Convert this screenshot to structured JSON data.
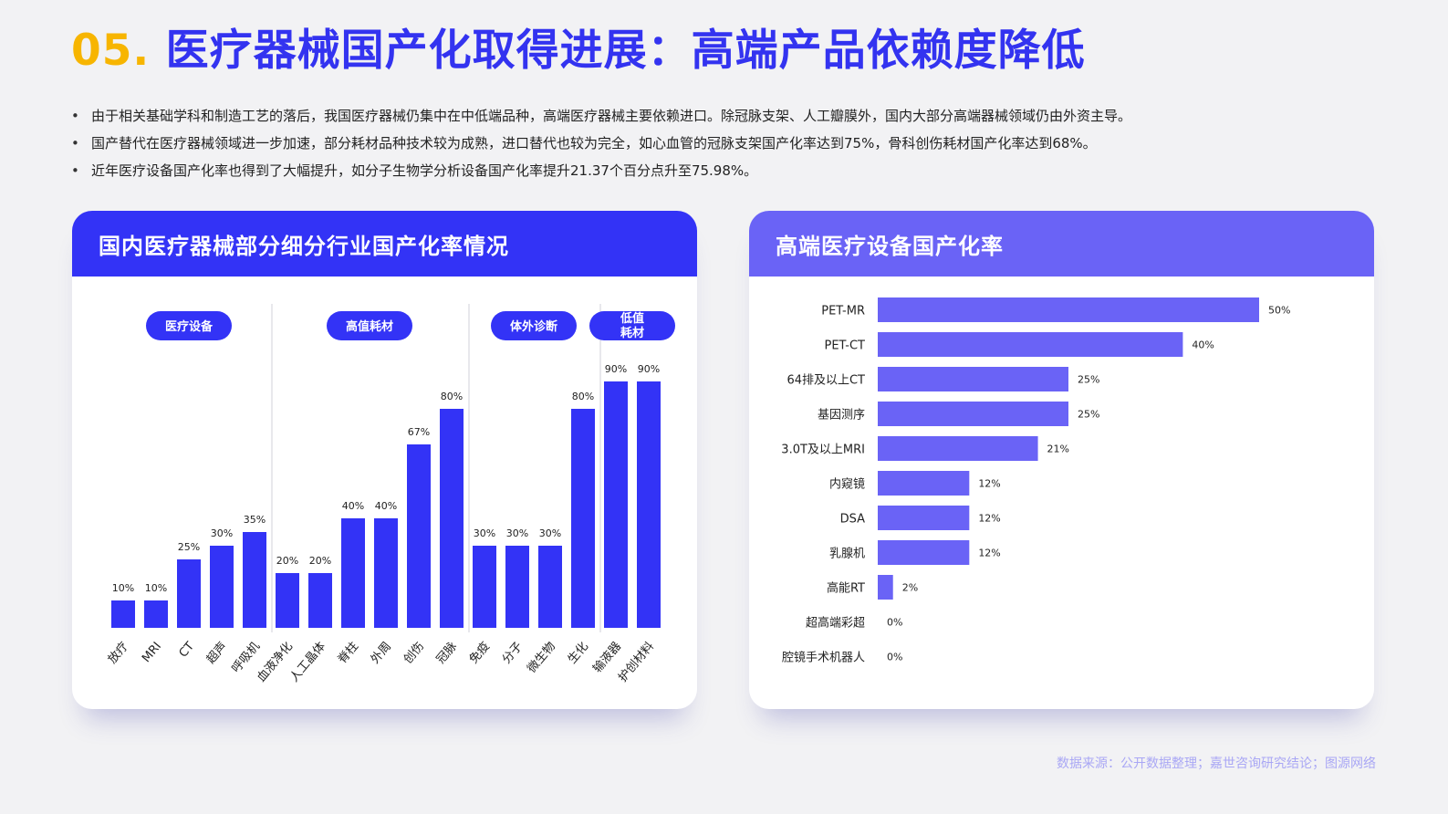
{
  "title": {
    "number": "05.",
    "text": "医疗器械国产化取得进展：高端产品依赖度降低"
  },
  "bullets": [
    "由于相关基础学科和制造工艺的落后，我国医疗器械仍集中在中低端品种，高端医疗器械主要依赖进口。除冠脉支架、人工瓣膜外，国内大部分高端器械领域仍由外资主导。",
    "国产替代在医疗器械领域进一步加速，部分耗材品种技术较为成熟，进口替代也较为完全，如心血管的冠脉支架国产化率达到75%，骨科创伤耗材国产化率达到68%。",
    "近年医疗设备国产化率也得到了大幅提升，如分子生物学分析设备国产化率提升21.37个百分点升至75.98%。"
  ],
  "colors": {
    "bar_left": "#3333f6",
    "bar_right": "#6a63f6",
    "title_number": "#f7b500",
    "title_text": "#3333f0"
  },
  "source": "数据来源：公开数据整理；嘉世咨询研究结论；图源网络",
  "chart_data": [
    {
      "type": "bar",
      "title": "国内医疗器械部分细分行业国产化率情况",
      "groups": [
        {
          "name": "医疗设备",
          "count": 5
        },
        {
          "name": "高值耗材",
          "count": 6
        },
        {
          "name": "体外诊断",
          "count": 4
        },
        {
          "name": "低值耗材",
          "count": 2
        }
      ],
      "categories": [
        "放疗",
        "MRI",
        "CT",
        "超声",
        "呼吸机",
        "血液净化",
        "人工晶体",
        "脊柱",
        "外周",
        "创伤",
        "冠脉",
        "免疫",
        "分子",
        "微生物",
        "生化",
        "输液器",
        "护创材料"
      ],
      "values": [
        10,
        10,
        25,
        30,
        35,
        20,
        20,
        40,
        40,
        67,
        80,
        30,
        30,
        30,
        80,
        90,
        90
      ],
      "labels": [
        "10%",
        "10%",
        "25%",
        "30%",
        "35%",
        "20%",
        "20%",
        "40%",
        "40%",
        "67%",
        "80%",
        "30%",
        "30%",
        "30%",
        "80%",
        "90%",
        "90%"
      ],
      "ylim": [
        0,
        100
      ]
    },
    {
      "type": "bar",
      "orientation": "horizontal",
      "title": "高端医疗设备国产化率",
      "categories": [
        "PET-MR",
        "PET-CT",
        "64排及以上CT",
        "基因测序",
        "3.0T及以上MRI",
        "内窥镜",
        "DSA",
        "乳腺机",
        "高能RT",
        "超高端彩超",
        "腔镜手术机器人"
      ],
      "values": [
        50,
        40,
        25,
        25,
        21,
        12,
        12,
        12,
        2,
        0,
        0
      ],
      "labels": [
        "50%",
        "40%",
        "25%",
        "25%",
        "21%",
        "12%",
        "12%",
        "12%",
        "2%",
        "0%",
        "0%"
      ],
      "xlim": [
        0,
        50
      ]
    }
  ]
}
